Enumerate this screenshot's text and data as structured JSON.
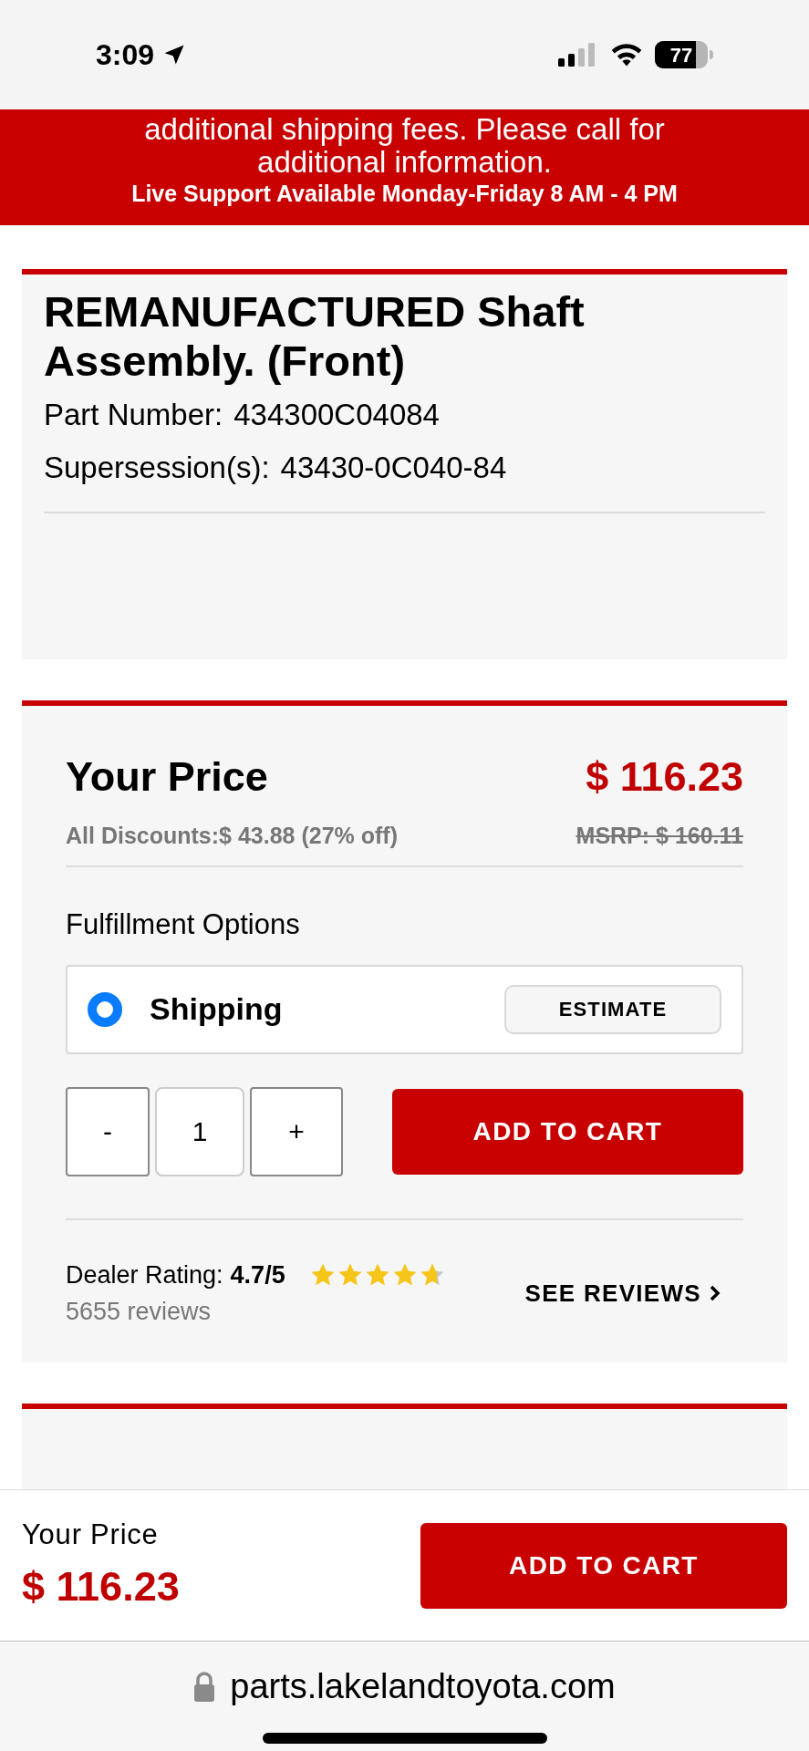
{
  "status_bar": {
    "time": "3:09",
    "battery": "77"
  },
  "notice": {
    "lines": [
      "additional shipping fees. Please call for",
      "additional information."
    ],
    "support": "Live Support Available Monday-Friday 8 AM - 4 PM"
  },
  "product": {
    "title": "REMANUFACTURED Shaft Assembly. (Front)",
    "part_number_label": "Part Number:",
    "part_number": "434300C04084",
    "supersession_label": "Supersession(s):",
    "supersession": "43430-0C040-84"
  },
  "pricing": {
    "label": "Your Price",
    "price": "$ 116.23",
    "discounts": "All Discounts:$ 43.88 (27% off)",
    "msrp": "MSRP: $ 160.11"
  },
  "fulfillment": {
    "heading": "Fulfillment Options",
    "options": [
      {
        "label": "Shipping",
        "selected": true,
        "action": "ESTIMATE"
      }
    ]
  },
  "quantity": {
    "minus": "-",
    "value": "1",
    "plus": "+"
  },
  "add_to_cart": "ADD TO CART",
  "rating": {
    "label": "Dealer Rating:",
    "score": "4.7/5",
    "stars": 4.7,
    "reviews": "5655 reviews",
    "link": "SEE REVIEWS"
  },
  "sticky_bar": {
    "label": "Your Price",
    "price": "$ 116.23",
    "button": "ADD TO CART"
  },
  "browser": {
    "url": "parts.lakelandtoyota.com"
  }
}
